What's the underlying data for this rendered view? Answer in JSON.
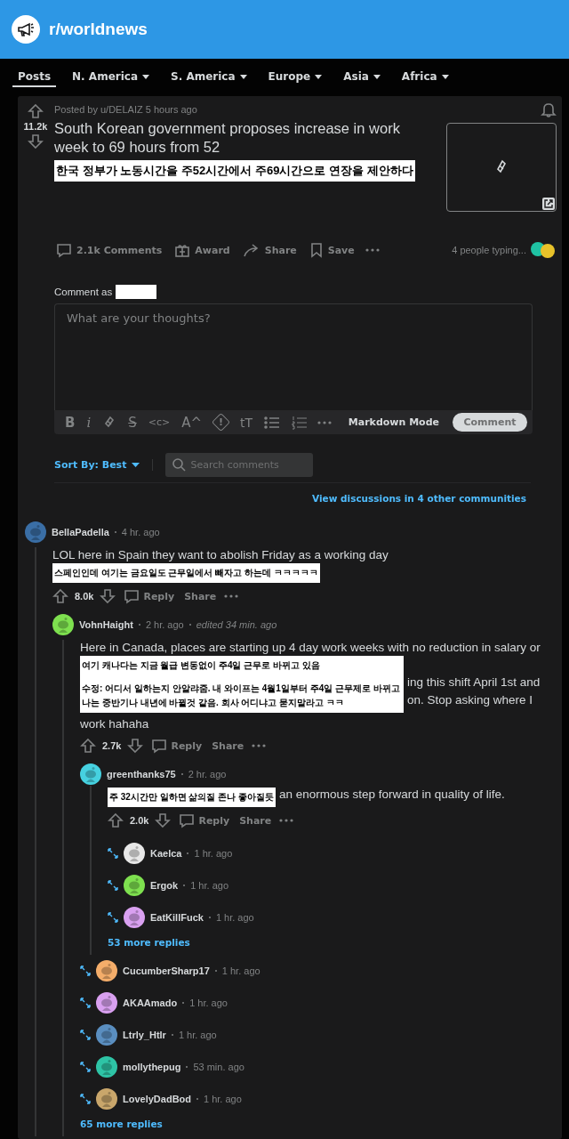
{
  "header": {
    "subreddit": "r/worldnews"
  },
  "nav": [
    {
      "label": "Posts",
      "selected": true,
      "has_menu": false
    },
    {
      "label": "N. America",
      "selected": false,
      "has_menu": true
    },
    {
      "label": "S. America",
      "selected": false,
      "has_menu": true
    },
    {
      "label": "Europe",
      "selected": false,
      "has_menu": true
    },
    {
      "label": "Asia",
      "selected": false,
      "has_menu": true
    },
    {
      "label": "Africa",
      "selected": false,
      "has_menu": true
    }
  ],
  "post": {
    "votes": "11.2k",
    "posted_by": "Posted by u/DELAIZ 5 hours ago",
    "title": "South Korean government proposes increase in work week to 69 hours from 52",
    "translation": "한국 정부가 노동시간을 주52시간에서 주69시간으로 연장을 제안하다",
    "actions": [
      {
        "kind": "comments",
        "label": "2.1k Comments"
      },
      {
        "kind": "award",
        "label": "Award"
      },
      {
        "kind": "share",
        "label": "Share"
      },
      {
        "kind": "save",
        "label": "Save"
      },
      {
        "kind": "more"
      }
    ],
    "typing": "4 people typing..."
  },
  "composer": {
    "comment_as": "Comment as",
    "placeholder": "What are your thoughts?",
    "toolbar": [
      {
        "kind": "bold",
        "label": "B"
      },
      {
        "kind": "italic",
        "label": "i"
      },
      {
        "kind": "link"
      },
      {
        "kind": "strike",
        "label": "S"
      },
      {
        "kind": "code",
        "label": "<c>"
      },
      {
        "kind": "super",
        "label": "A^"
      },
      {
        "kind": "spoiler",
        "label": "!"
      },
      {
        "kind": "heading",
        "label": "tT"
      },
      {
        "kind": "bullets"
      },
      {
        "kind": "numbers"
      },
      {
        "kind": "more"
      }
    ],
    "markdown_mode": "Markdown Mode",
    "submit": "Comment"
  },
  "sort": {
    "label": "Sort By: Best",
    "search_placeholder": "Search comments"
  },
  "other_communities": "View discussions in 4 other communities",
  "comments": [
    {
      "kind": "full",
      "user": "BellaPadella",
      "time": "4 hr. ago",
      "color": "#3a6ea5",
      "text": "LOL here in Spain they want to abolish Friday as a working day",
      "overlay": [
        "스페인인데 여기는 금요일도 근무일에서 빼자고 하는데 ㅋㅋㅋㅋㅋ"
      ],
      "votes": "8.0k",
      "reply": "Reply",
      "share": "Share",
      "children": [
        {
          "kind": "full",
          "user": "VohnHaight",
          "time": "2 hr. ago",
          "edited": "edited 34 min. ago",
          "color": "#7ee04f",
          "text": "Here in Canada, places are starting up 4 day work weeks with no reduction in salary or",
          "overlay": [
            "여기 캐나다는 지금 월급 변동없이 주4일 근무로 바뀌고 있음",
            "수정: 어디서 일하는지 안알랴줌. 내 와이프는 4월1일부터 주4일 근무제로 바뀌고 나는 중반기나 내년에 바뀔것 같음. 회사 어디냐고 묻지말라고 ㅋㅋ"
          ],
          "beside": [
            "ing this shift April 1st and",
            "on. Stop asking where I"
          ],
          "after": "work hahaha",
          "votes": "2.7k",
          "reply": "Reply",
          "share": "Share",
          "more": "65 more replies",
          "children": [
            {
              "kind": "full",
              "user": "greenthanks75",
              "time": "2 hr. ago",
              "color": "#46d1e0",
              "overlay": [
                "주 32시간만 일하면 삶의질 존나 좋아질듯"
              ],
              "beside": [
                "an enormous step forward in quality of life."
              ],
              "votes": "2.0k",
              "reply": "Reply",
              "share": "Share",
              "more": "53 more replies",
              "children": [
                {
                  "kind": "collapsed",
                  "user": "Kaelca",
                  "time": "1 hr. ago",
                  "color": "#e8e8e8"
                },
                {
                  "kind": "collapsed",
                  "user": "Ergok",
                  "time": "1 hr. ago",
                  "color": "#7ee04f"
                },
                {
                  "kind": "collapsed",
                  "user": "EatKillFuck",
                  "time": "1 hr. ago",
                  "color": "#d9a0f0"
                }
              ]
            },
            {
              "kind": "collapsed",
              "user": "CucumberSharp17",
              "time": "1 hr. ago",
              "color": "#f4ad6a"
            },
            {
              "kind": "collapsed",
              "user": "AKAAmado",
              "time": "1 hr. ago",
              "color": "#d9a0f0"
            },
            {
              "kind": "collapsed",
              "user": "Ltrly_Htlr",
              "time": "1 hr. ago",
              "color": "#5a8ec0"
            },
            {
              "kind": "collapsed",
              "user": "mollythepug",
              "time": "53 min. ago",
              "color": "#2ec4a6"
            },
            {
              "kind": "collapsed",
              "user": "LovelyDadBod",
              "time": "1 hr. ago",
              "color": "#c9a66b"
            }
          ]
        }
      ]
    }
  ]
}
